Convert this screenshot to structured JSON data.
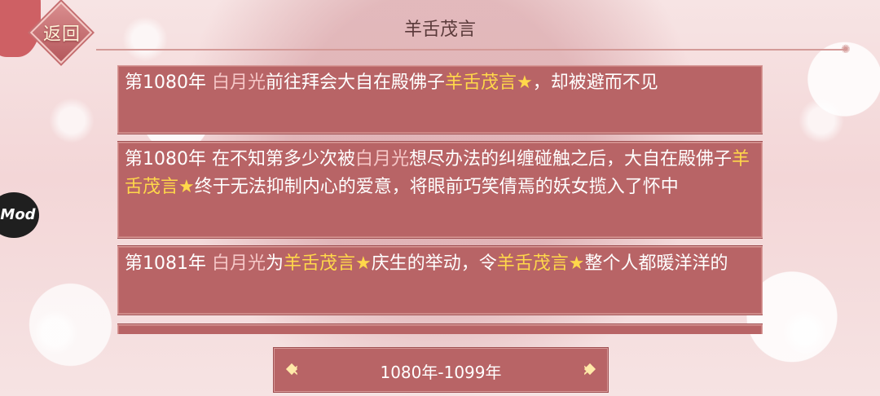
{
  "header": {
    "back_label": "返回",
    "title": "羊舌茂言"
  },
  "entries": [
    {
      "segments": [
        {
          "t": "第1080年 ",
          "s": "plain"
        },
        {
          "t": "白月光",
          "s": "name"
        },
        {
          "t": "前往拜会大自在殿佛子",
          "s": "plain"
        },
        {
          "t": "羊舌茂言★",
          "s": "gold"
        },
        {
          "t": "，却被避而不见",
          "s": "plain"
        }
      ]
    },
    {
      "segments": [
        {
          "t": "第1080年 在不知第多少次被",
          "s": "plain"
        },
        {
          "t": "白月光",
          "s": "name"
        },
        {
          "t": "想尽办法的纠缠碰触之后，大自在殿佛子",
          "s": "plain"
        },
        {
          "t": "羊舌茂言★",
          "s": "gold"
        },
        {
          "t": "终于无法抑制内心的爱意，将眼前巧笑倩焉的妖女揽入了怀中",
          "s": "plain"
        }
      ]
    },
    {
      "segments": [
        {
          "t": "第1081年 ",
          "s": "plain"
        },
        {
          "t": "白月光",
          "s": "name"
        },
        {
          "t": "为",
          "s": "plain"
        },
        {
          "t": "羊舌茂言★",
          "s": "gold"
        },
        {
          "t": "庆生的举动，令",
          "s": "plain"
        },
        {
          "t": "羊舌茂言★",
          "s": "gold"
        },
        {
          "t": "整个人都暖洋洋的",
          "s": "plain"
        }
      ]
    }
  ],
  "footer": {
    "range_label": "1080年-1099年",
    "prev_icon": "left-chevron-ornament",
    "next_icon": "right-chevron-ornament"
  },
  "mod_label": "Mod",
  "colors": {
    "entry_bg": "#b86466",
    "name": "#f6c7c7",
    "gold": "#ffd84a"
  }
}
